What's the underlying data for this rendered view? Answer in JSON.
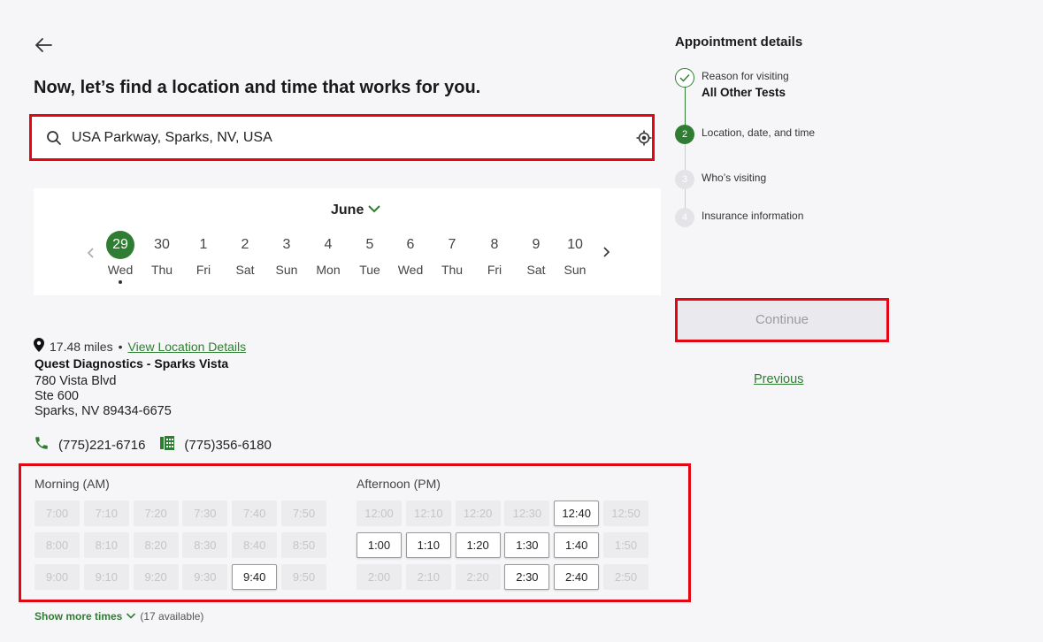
{
  "header": {
    "title": "Now, let’s find a location and time that works for you."
  },
  "search": {
    "value": "USA Parkway, Sparks, NV, USA"
  },
  "calendar": {
    "month": "June",
    "days": [
      {
        "num": "29",
        "dow": "Wed",
        "selected": true
      },
      {
        "num": "30",
        "dow": "Thu"
      },
      {
        "num": "1",
        "dow": "Fri"
      },
      {
        "num": "2",
        "dow": "Sat"
      },
      {
        "num": "3",
        "dow": "Sun"
      },
      {
        "num": "4",
        "dow": "Mon"
      },
      {
        "num": "5",
        "dow": "Tue"
      },
      {
        "num": "6",
        "dow": "Wed"
      },
      {
        "num": "7",
        "dow": "Thu"
      },
      {
        "num": "8",
        "dow": "Fri"
      },
      {
        "num": "9",
        "dow": "Sat"
      },
      {
        "num": "10",
        "dow": "Sun"
      }
    ]
  },
  "location": {
    "distance": "17.48 miles",
    "details_link": "View Location Details",
    "name": "Quest Diagnostics - Sparks Vista",
    "address_lines": [
      "780 Vista Blvd",
      "Ste 600",
      "Sparks, NV 89434-6675"
    ],
    "phone": "(775)221-6716",
    "fax": "(775)356-6180"
  },
  "times": {
    "morning_label": "Morning (AM)",
    "afternoon_label": "Afternoon (PM)",
    "morning": [
      [
        {
          "t": "7:00",
          "a": false
        },
        {
          "t": "7:10",
          "a": false
        },
        {
          "t": "7:20",
          "a": false
        },
        {
          "t": "7:30",
          "a": false
        },
        {
          "t": "7:40",
          "a": false
        },
        {
          "t": "7:50",
          "a": false
        }
      ],
      [
        {
          "t": "8:00",
          "a": false
        },
        {
          "t": "8:10",
          "a": false
        },
        {
          "t": "8:20",
          "a": false
        },
        {
          "t": "8:30",
          "a": false
        },
        {
          "t": "8:40",
          "a": false
        },
        {
          "t": "8:50",
          "a": false
        }
      ],
      [
        {
          "t": "9:00",
          "a": false
        },
        {
          "t": "9:10",
          "a": false
        },
        {
          "t": "9:20",
          "a": false
        },
        {
          "t": "9:30",
          "a": false
        },
        {
          "t": "9:40",
          "a": true
        },
        {
          "t": "9:50",
          "a": false
        }
      ]
    ],
    "afternoon": [
      [
        {
          "t": "12:00",
          "a": false
        },
        {
          "t": "12:10",
          "a": false
        },
        {
          "t": "12:20",
          "a": false
        },
        {
          "t": "12:30",
          "a": false
        },
        {
          "t": "12:40",
          "a": true
        },
        {
          "t": "12:50",
          "a": false
        }
      ],
      [
        {
          "t": "1:00",
          "a": true
        },
        {
          "t": "1:10",
          "a": true
        },
        {
          "t": "1:20",
          "a": true
        },
        {
          "t": "1:30",
          "a": true
        },
        {
          "t": "1:40",
          "a": true
        },
        {
          "t": "1:50",
          "a": false
        }
      ],
      [
        {
          "t": "2:00",
          "a": false
        },
        {
          "t": "2:10",
          "a": false
        },
        {
          "t": "2:20",
          "a": false
        },
        {
          "t": "2:30",
          "a": true
        },
        {
          "t": "2:40",
          "a": true
        },
        {
          "t": "2:50",
          "a": false
        }
      ]
    ],
    "show_more": "Show more times",
    "available": "(17 available)"
  },
  "sidebar": {
    "title": "Appointment details",
    "steps": [
      {
        "marker": "check",
        "label": "Reason for visiting",
        "value": "All Other Tests"
      },
      {
        "marker": "2",
        "label": "Location, date, and time"
      },
      {
        "marker": "3",
        "label": "Who’s visiting"
      },
      {
        "marker": "4",
        "label": "Insurance information"
      }
    ],
    "continue": "Continue",
    "previous": "Previous"
  },
  "colors": {
    "accent": "#2f7d32",
    "highlight": "#e30613"
  }
}
